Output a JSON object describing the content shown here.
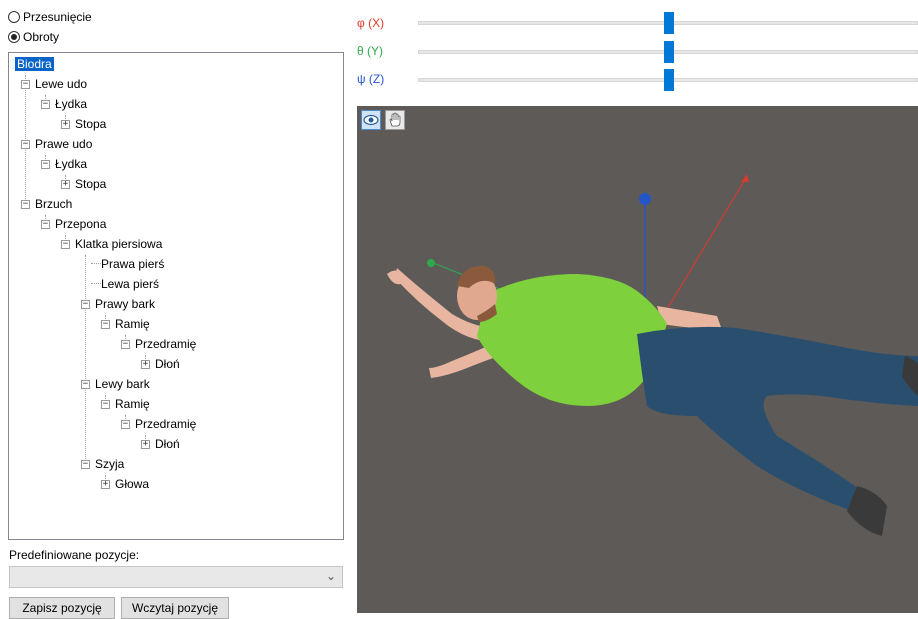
{
  "mode": {
    "options": [
      {
        "label": "Przesunięcie",
        "checked": false
      },
      {
        "label": "Obroty",
        "checked": true
      }
    ]
  },
  "tree": {
    "nodes": [
      {
        "label": "Biodra",
        "selected": true
      },
      {
        "label": "Lewe udo"
      },
      {
        "label": "Łydka"
      },
      {
        "label": "Stopa"
      },
      {
        "label": "Prawe udo"
      },
      {
        "label": "Łydka"
      },
      {
        "label": "Stopa"
      },
      {
        "label": "Brzuch"
      },
      {
        "label": "Przepona"
      },
      {
        "label": "Klatka piersiowa"
      },
      {
        "label": "Prawa pierś"
      },
      {
        "label": "Lewa pierś"
      },
      {
        "label": "Prawy bark"
      },
      {
        "label": "Ramię"
      },
      {
        "label": "Przedramię"
      },
      {
        "label": "Dłoń"
      },
      {
        "label": "Lewy bark"
      },
      {
        "label": "Ramię"
      },
      {
        "label": "Przedramię"
      },
      {
        "label": "Dłoń"
      },
      {
        "label": "Szyja"
      },
      {
        "label": "Głowa"
      }
    ]
  },
  "predefined": {
    "label": "Predefiniowane pozycje:",
    "selected": ""
  },
  "buttons": {
    "save": "Zapisz pozycję",
    "load": "Wczytaj pozycję"
  },
  "sliders": [
    {
      "label": "φ (X)",
      "color": "#e0392b",
      "value": 0.5
    },
    {
      "label": "θ (Y)",
      "color": "#2fa84f",
      "value": 0.5
    },
    {
      "label": "ψ (Z)",
      "color": "#2456c8",
      "value": 0.5
    }
  ],
  "viewport": {
    "tools": [
      "eye-icon",
      "hand-icon"
    ],
    "background": "#5e5a57",
    "axis_colors": {
      "x": "#d43a2f",
      "y": "#2fa84f",
      "z": "#2456c8"
    },
    "model_colors": {
      "shirt": "#7ed13c",
      "jeans": "#2a4f6e",
      "skin": "#e8b6a0",
      "hair": "#8b5a3c"
    }
  }
}
